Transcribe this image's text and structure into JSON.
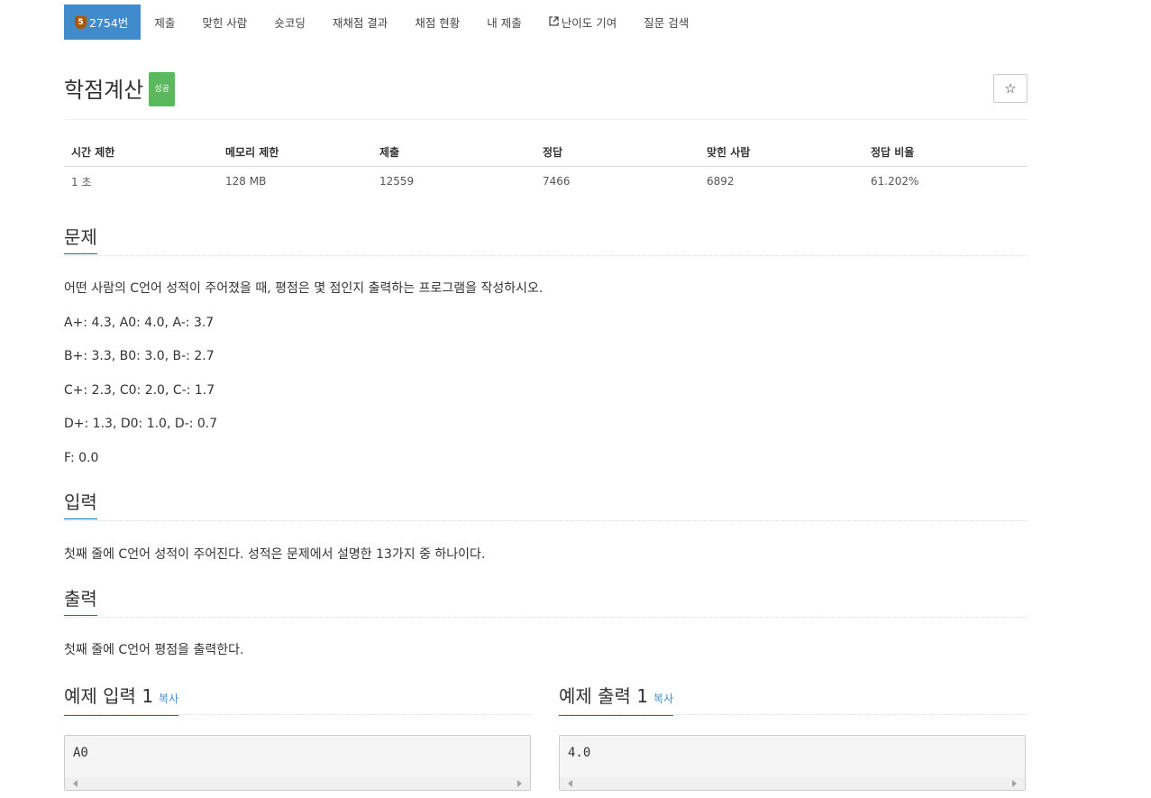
{
  "nav": {
    "problem_number": "2754번",
    "tier_digit": "5",
    "submit": "제출",
    "solvers": "맞힌 사람",
    "shortcoding": "숏코딩",
    "rejudge": "재채점 결과",
    "status": "채점 현황",
    "my_submissions": "내 제출",
    "difficulty": "난이도 기여",
    "qna_search": "질문 검색"
  },
  "problem": {
    "title": "학점계산",
    "badge": "성공",
    "star_icon": "☆"
  },
  "info_table": {
    "headers": [
      "시간 제한",
      "메모리 제한",
      "제출",
      "정답",
      "맞힌 사람",
      "정답 비율"
    ],
    "values": [
      "1 초",
      "128 MB",
      "12559",
      "7466",
      "6892",
      "61.202%"
    ]
  },
  "sections": {
    "description_title": "문제",
    "description": [
      "어떤 사람의 C언어 성적이 주어졌을 때, 평점은 몇 점인지 출력하는 프로그램을 작성하시오.",
      "A+: 4.3, A0: 4.0, A-: 3.7",
      "B+: 3.3, B0: 3.0, B-: 2.7",
      "C+: 2.3, C0: 2.0, C-: 1.7",
      "D+: 1.3, D0: 1.0, D-: 0.7",
      "F: 0.0"
    ],
    "input_title": "입력",
    "input": "첫째 줄에 C언어 성적이 주어진다. 성적은 문제에서 설명한 13가지 중 하나이다.",
    "output_title": "출력",
    "output": "첫째 줄에 C언어 평점을 출력한다."
  },
  "samples": {
    "input_title": "예제 입력 1",
    "output_title": "예제 출력 1",
    "copy_label": "복사",
    "input_value": "A0",
    "output_value": "4.0"
  },
  "colors": {
    "nav_active": "#428bca",
    "badge_success": "#5cb85c",
    "section_underline": "#0076c0",
    "link": "#428bca"
  }
}
